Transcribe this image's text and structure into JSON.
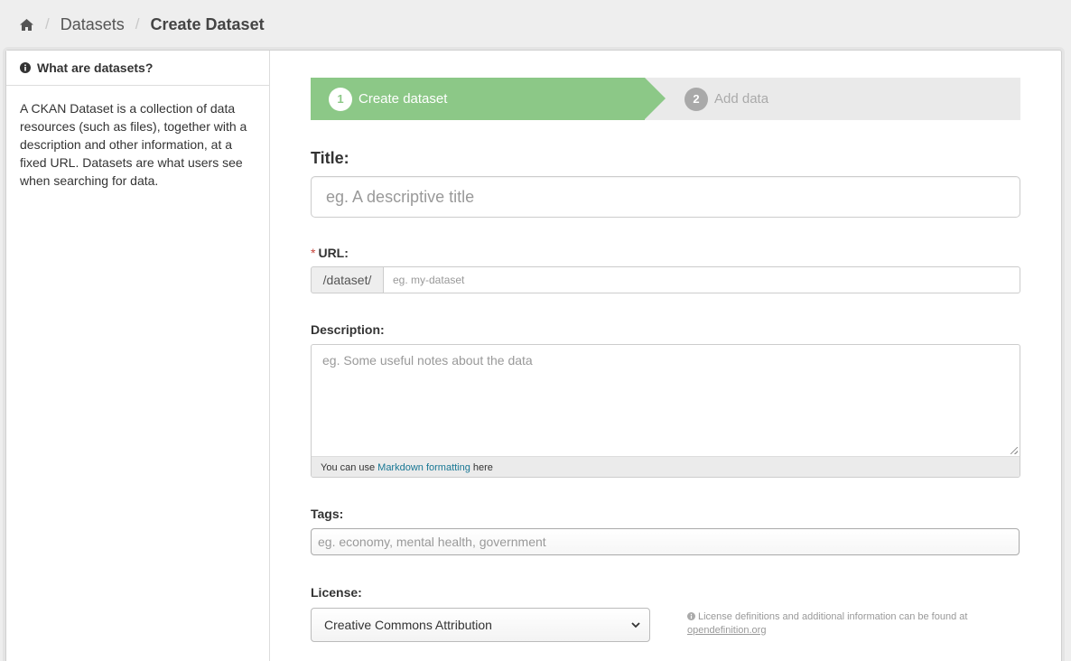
{
  "breadcrumb": {
    "home_icon": "home-icon",
    "items": [
      "Datasets",
      "Create Dataset"
    ]
  },
  "sidebar": {
    "heading": "What are datasets?",
    "heading_icon": "info-icon",
    "text": "A CKAN Dataset is a collection of data resources (such as files), together with a description and other information, at a fixed URL. Datasets are what users see when searching for data."
  },
  "stages": [
    {
      "number": "1",
      "label": "Create dataset",
      "state": "active"
    },
    {
      "number": "2",
      "label": "Add data",
      "state": "inactive"
    }
  ],
  "form": {
    "title": {
      "label": "Title:",
      "placeholder": "eg. A descriptive title"
    },
    "url": {
      "required_mark": "*",
      "label": "URL:",
      "prefix": "/dataset/",
      "placeholder": "eg. my-dataset"
    },
    "description": {
      "label": "Description:",
      "placeholder": "eg. Some useful notes about the data",
      "help_prefix": "You can use",
      "help_link": "Markdown formatting",
      "help_suffix": "here"
    },
    "tags": {
      "label": "Tags:",
      "placeholder": "eg. economy, mental health, government"
    },
    "license": {
      "label": "License:",
      "selected": "Creative Commons Attribution",
      "info_text": "License definitions and additional information can be found at",
      "info_link": "opendefinition.org"
    }
  },
  "colors": {
    "stage_active": "#8cc887",
    "stage_inactive_bg": "#eaeaea",
    "required": "#c6443b",
    "link": "#187794"
  }
}
